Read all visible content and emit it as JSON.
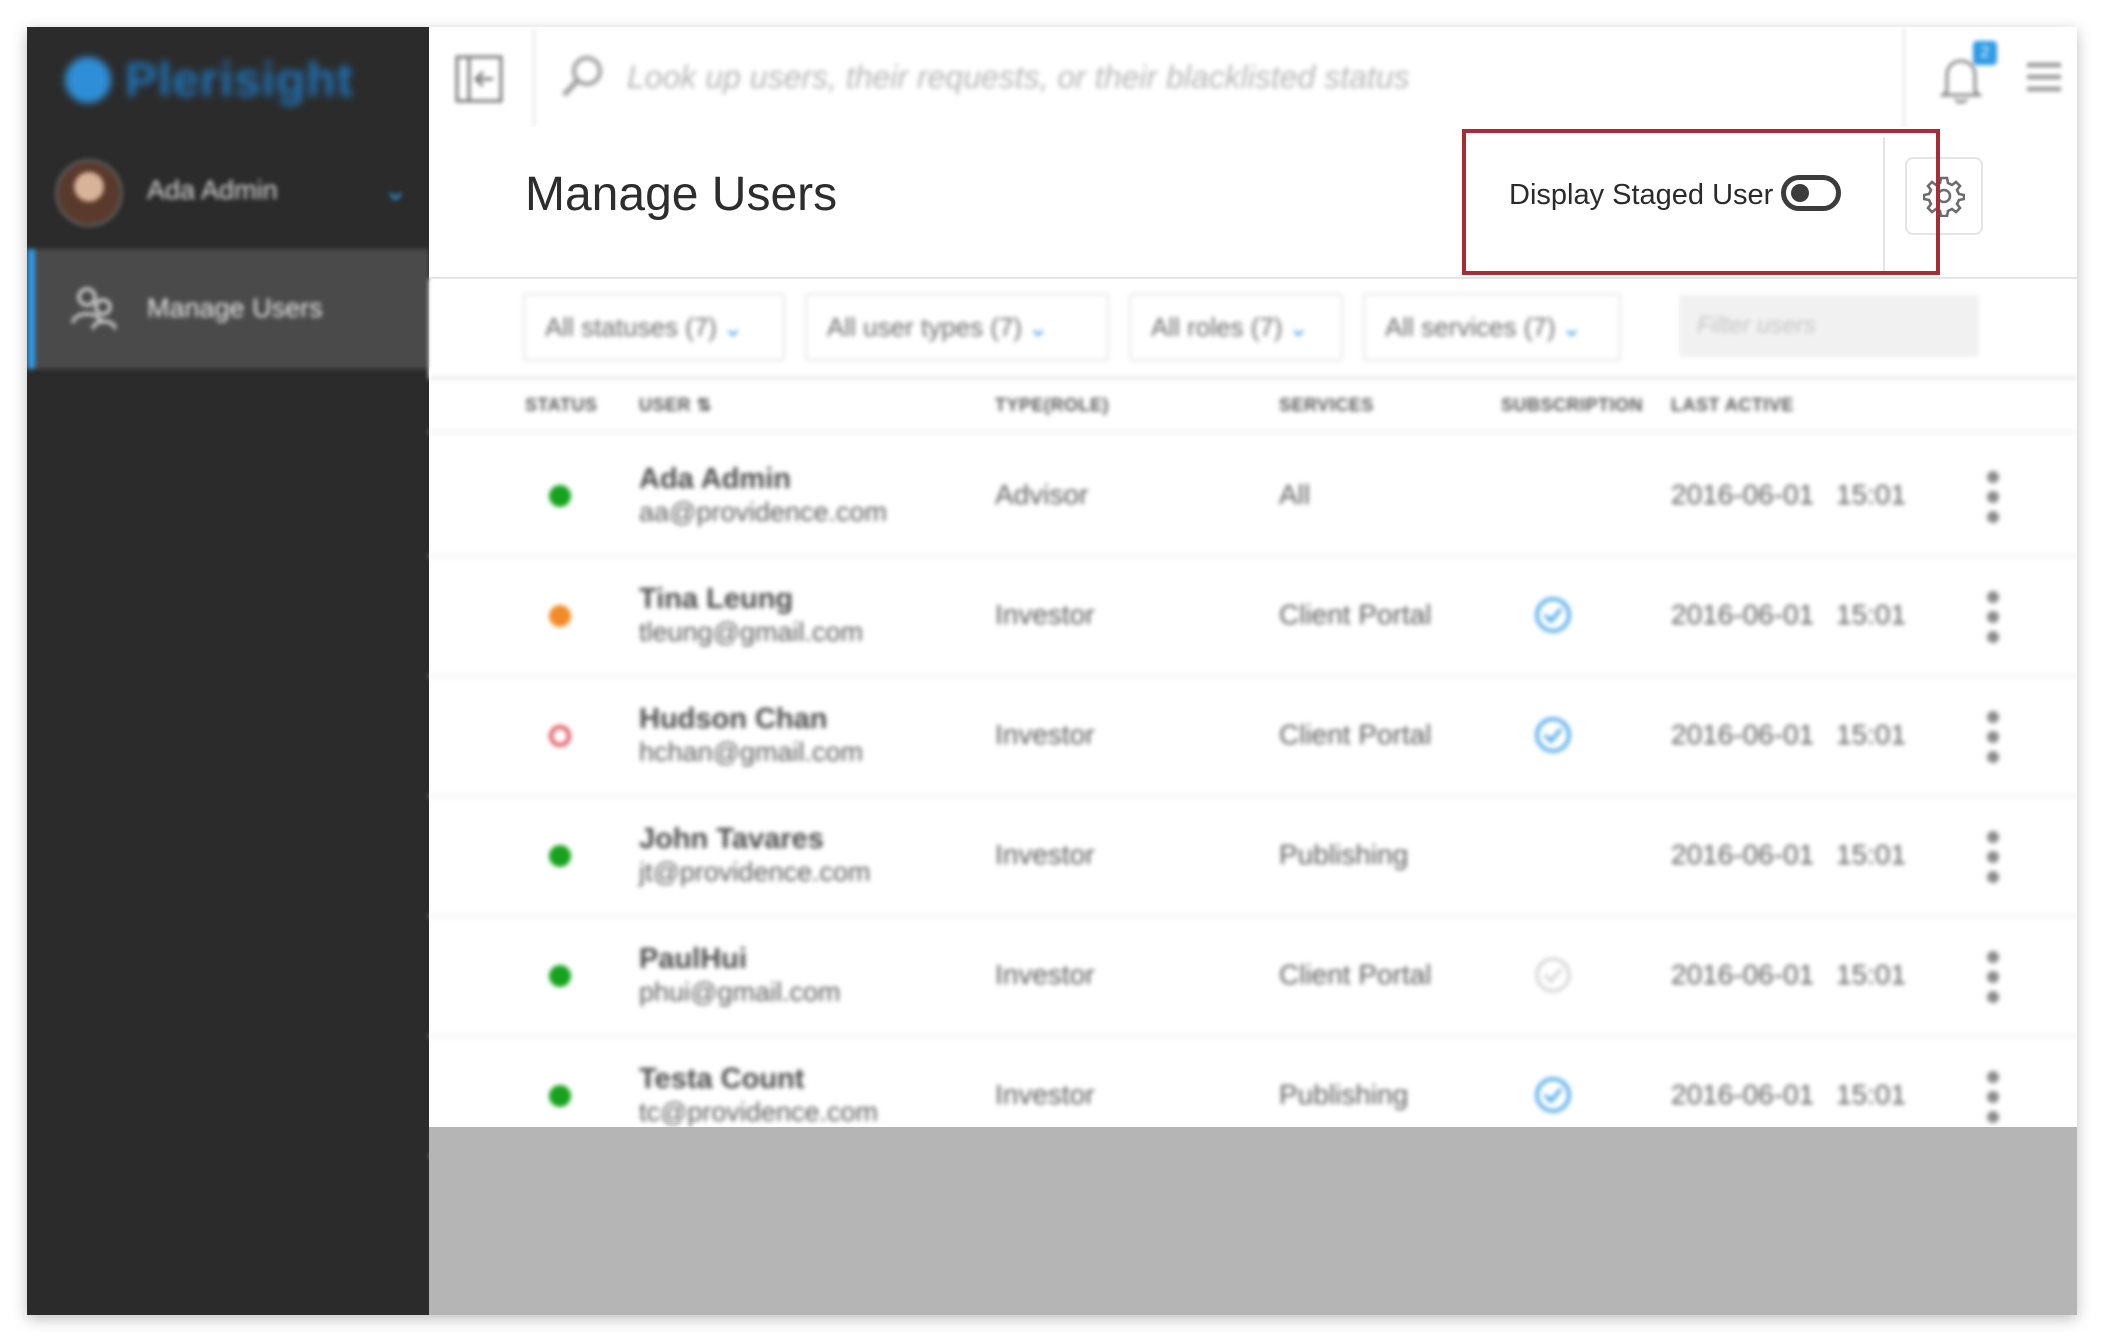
{
  "app": {
    "brand_name": "Plerisight"
  },
  "sidebar": {
    "user_name": "Ada Admin",
    "nav_items": [
      {
        "label": "Manage Users",
        "icon": "users-icon"
      }
    ]
  },
  "topbar": {
    "search_placeholder": "Look up users, their requests, or their blacklisted status",
    "notification_count": "2"
  },
  "header": {
    "title": "Manage Users",
    "staged_toggle_label": "Display Staged User",
    "staged_toggle_on": false
  },
  "filters": {
    "statuses": "All statuses (7)",
    "user_types": "All user types (7)",
    "roles": "All roles (7)",
    "services": "All services (7)",
    "search_placeholder": "Filter users"
  },
  "table": {
    "columns": {
      "status": "STATUS",
      "user": "USER",
      "type_role": "TYPE(ROLE)",
      "services": "SERVICES",
      "subscription": "SUBSCRIPTION",
      "last_active": "LAST ACTIVE"
    },
    "rows": [
      {
        "name": "Ada Admin",
        "email": "aa@providence.com",
        "type": "Advisor",
        "services": "All",
        "subscription": "none",
        "last_active": "2016-06-01 15:01",
        "status": "active"
      },
      {
        "name": "Tina Leung",
        "email": "tleung@gmail.com",
        "type": "Investor",
        "services": "Client Portal",
        "subscription": "checked",
        "last_active": "2016-06-01 15:01",
        "status": "pending"
      },
      {
        "name": "Hudson Chan",
        "email": "hchan@gmail.com",
        "type": "Investor",
        "services": "Client Portal",
        "subscription": "checked",
        "last_active": "2016-06-01 15:01",
        "status": "inactive"
      },
      {
        "name": "John Tavares",
        "email": "jt@providence.com",
        "type": "Investor",
        "services": "Publishing",
        "subscription": "none",
        "last_active": "2016-06-01 15:01",
        "status": "active"
      },
      {
        "name": "PaulHui",
        "email": "phui@gmail.com",
        "type": "Investor",
        "services": "Client Portal",
        "subscription": "unchecked",
        "last_active": "2016-06-01 15:01",
        "status": "active"
      },
      {
        "name": "Testa Count",
        "email": "tc@providence.com",
        "type": "Investor",
        "services": "Publishing",
        "subscription": "checked",
        "last_active": "2016-06-01 15:01",
        "status": "active"
      }
    ]
  },
  "colors": {
    "sidebar_bg": "#2b2b2b",
    "accent": "#2e9ae6",
    "status_active": "#17a21d",
    "status_pending": "#f28c28",
    "status_inactive": "#e0565e",
    "highlight": "#a72c35"
  }
}
